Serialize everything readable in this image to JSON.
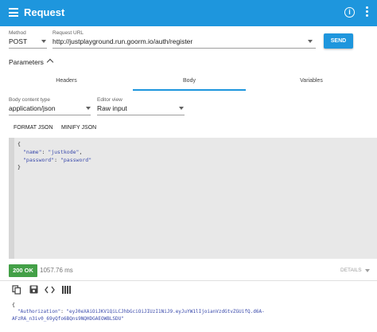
{
  "appbar": {
    "title": "Request",
    "menu_icon": "menu-icon",
    "info_icon": "info-icon",
    "more_icon": "more-vert-icon",
    "color": "#1e96dd"
  },
  "request": {
    "method_label": "Method",
    "method_value": "POST",
    "url_label": "Request URL",
    "url_value": "http://justplayground.run.goorm.io/auth/register",
    "send_label": "SEND"
  },
  "parameters": {
    "label": "Parameters",
    "tabs": [
      "Headers",
      "Body",
      "Variables"
    ],
    "active_tab": "Body"
  },
  "body_settings": {
    "content_type_label": "Body content type",
    "content_type_value": "application/json",
    "editor_view_label": "Editor view",
    "editor_view_value": "Raw input",
    "format_json_label": "FORMAT JSON",
    "minify_json_label": "MINIFY JSON"
  },
  "body_editor": {
    "line_open": "{",
    "name_key": "\"name\"",
    "name_value": "\"justkode\"",
    "password_key": "\"password\"",
    "password_value": "\"password\"",
    "line_close": "}"
  },
  "response": {
    "status": "200 OK",
    "status_color": "#43a047",
    "time": "1057.76 ms",
    "details_label": "DETAILS",
    "toolbar_icons": [
      "copy-icon",
      "save-icon",
      "code-icon",
      "table-icon"
    ],
    "line_open": "{",
    "auth_key": "\"Authorization\"",
    "auth_value_1": "\"eyJ0eXAiOiJKV1QiLCJhbGciOiJIUzI1NiJ9.eyJuYW1lIjoianVzdGtvZGUifQ.d6A-",
    "auth_value_2": "AFzRA_n3iv0_69yQfo6BQns9NQHDGAEOWBLSDU\""
  }
}
